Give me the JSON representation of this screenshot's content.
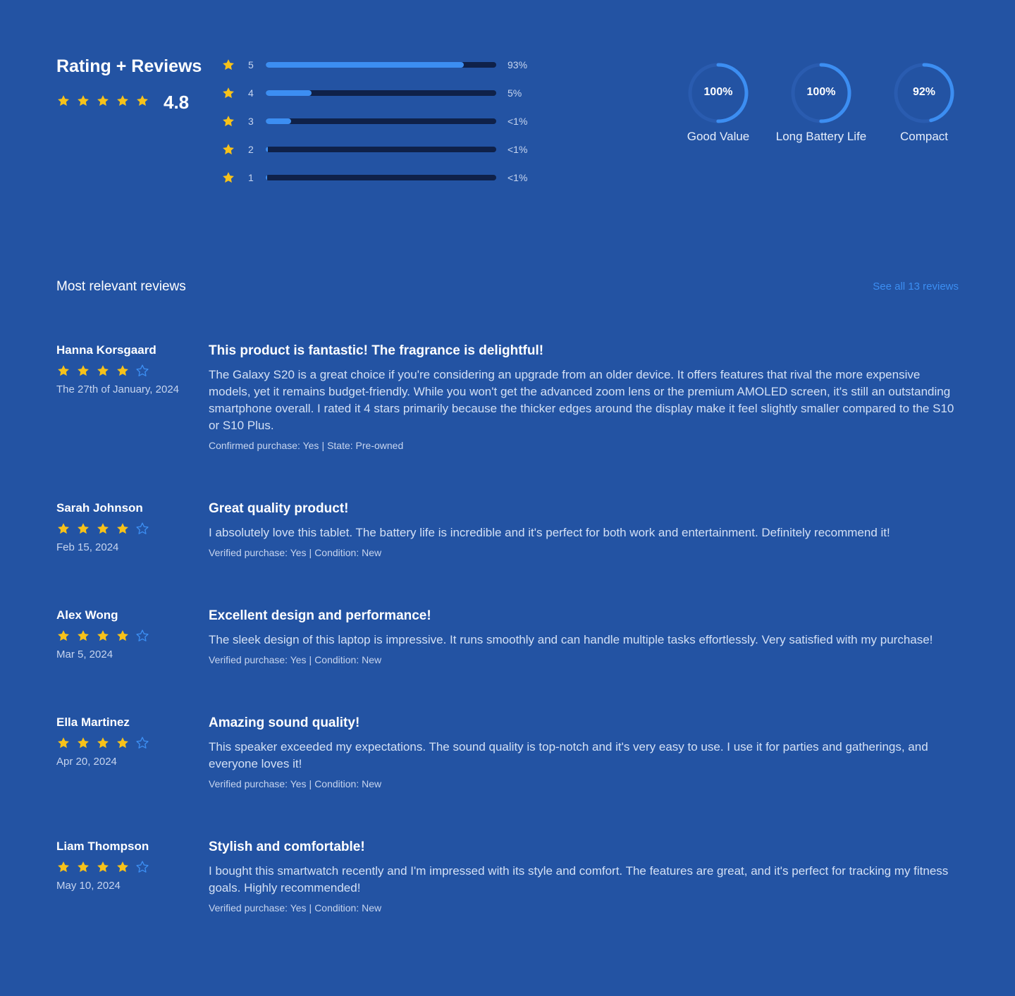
{
  "summary": {
    "title": "Rating + Reviews",
    "average": "4.8",
    "average_stars": 5,
    "distribution": [
      {
        "stars": "5",
        "percent_label": "93%",
        "fill_fraction": 0.86
      },
      {
        "stars": "4",
        "percent_label": "5%",
        "fill_fraction": 0.2
      },
      {
        "stars": "3",
        "percent_label": "<1%",
        "fill_fraction": 0.11
      },
      {
        "stars": "2",
        "percent_label": "<1%",
        "fill_fraction": 0.01
      },
      {
        "stars": "1",
        "percent_label": "<1%",
        "fill_fraction": 0.005
      }
    ]
  },
  "attributes": [
    {
      "value": "100%",
      "label": "Good Value",
      "fraction": 1.0
    },
    {
      "value": "100%",
      "label": "Long Battery Life",
      "fraction": 1.0
    },
    {
      "value": "92%",
      "label": "Compact",
      "fraction": 0.92
    }
  ],
  "reviews_section": {
    "title": "Most relevant reviews",
    "see_all": "See all 13 reviews"
  },
  "reviews": [
    {
      "name": "Hanna Korsgaard",
      "rating": 4,
      "date": "The 27th of January, 2024",
      "title": "This product is fantastic! The fragrance is delightful!",
      "body": "The Galaxy S20 is a great choice if you're considering an upgrade from an older device. It offers features that rival the more expensive models, yet it remains budget-friendly. While you won't get the advanced zoom lens or the premium AMOLED screen, it's still an outstanding smartphone overall. I rated it 4 stars primarily because the thicker edges around the display make it feel slightly smaller compared to the S10 or S10 Plus.",
      "meta1": "Confirmed purchase: Yes",
      "meta2": "State: Pre-owned"
    },
    {
      "name": "Sarah Johnson",
      "rating": 4,
      "date": "Feb 15, 2024",
      "title": "Great quality product!",
      "body": "I absolutely love this tablet. The battery life is incredible and it's perfect for both work and entertainment. Definitely recommend it!",
      "meta1": "Verified purchase: Yes",
      "meta2": "Condition: New"
    },
    {
      "name": "Alex Wong",
      "rating": 4,
      "date": "Mar 5, 2024",
      "title": "Excellent design and performance!",
      "body": "The sleek design of this laptop is impressive. It runs smoothly and can handle multiple tasks effortlessly. Very satisfied with my purchase!",
      "meta1": "Verified purchase: Yes",
      "meta2": "Condition: New"
    },
    {
      "name": "Ella Martinez",
      "rating": 4,
      "date": "Apr 20, 2024",
      "title": "Amazing sound quality!",
      "body": "This speaker exceeded my expectations. The sound quality is top-notch and it's very easy to use. I use it for parties and gatherings, and everyone loves it!",
      "meta1": "Verified purchase: Yes",
      "meta2": "Condition: New"
    },
    {
      "name": "Liam Thompson",
      "rating": 4,
      "date": "May 10, 2024",
      "title": "Stylish and comfortable!",
      "body": "I bought this smartwatch recently and I'm impressed with its style and comfort. The features are great, and it's perfect for tracking my fitness goals. Highly recommended!",
      "meta1": "Verified purchase: Yes",
      "meta2": "Condition: New"
    }
  ],
  "colors": {
    "background": "#2353a3",
    "star_filled": "#f7c21a",
    "star_empty_outline": "#3c8ef2",
    "bar_fill": "#3c8ef2",
    "bar_track": "#0f2149",
    "link": "#3c8ef2"
  }
}
